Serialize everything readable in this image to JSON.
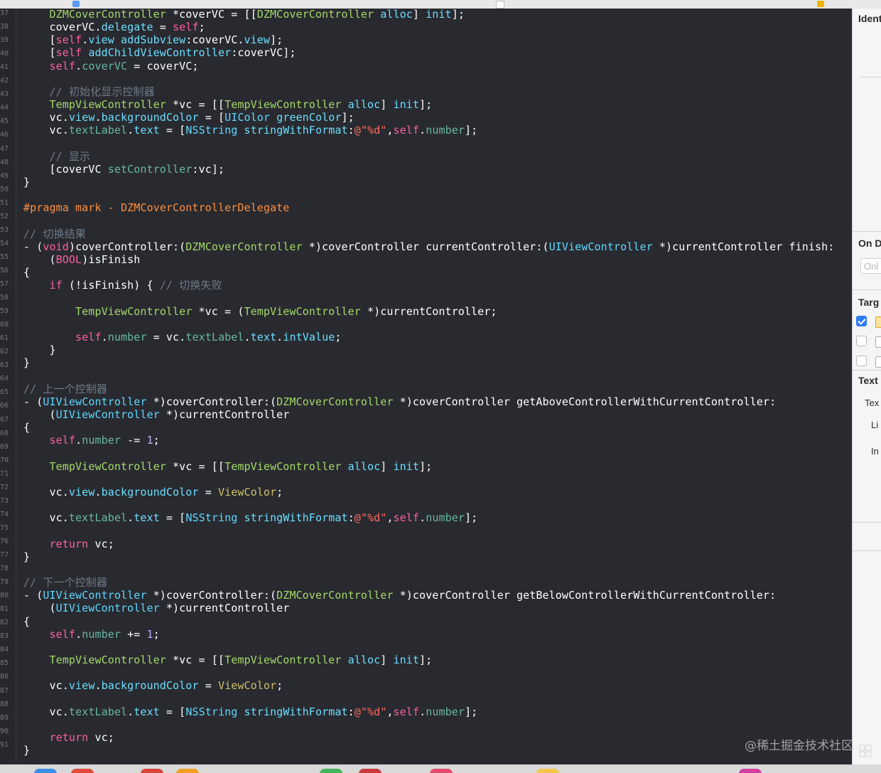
{
  "line_numbers": [
    "37",
    "38",
    "39",
    "40",
    "41",
    "42",
    "43",
    "44",
    "45",
    "46",
    "47",
    "48",
    "49",
    "50",
    "51",
    "52",
    "53",
    "54",
    "55",
    "56",
    "57",
    "58",
    "59",
    "60",
    "61",
    "62",
    "63",
    "64",
    "65",
    "66",
    "67",
    "68",
    "69",
    "70",
    "71",
    "72",
    "73",
    "74",
    "75",
    "76",
    "77",
    "78",
    "79",
    "80",
    "81",
    "82",
    "83",
    "84",
    "85",
    "86",
    "87",
    "88",
    "89",
    "90",
    "91"
  ],
  "code_lines": [
    [
      [
        "    ",
        "pl"
      ],
      [
        "DZMCoverController",
        "ty"
      ],
      [
        " *coverVC = [[",
        "pl"
      ],
      [
        "DZMCoverController",
        "ty"
      ],
      [
        " ",
        "pl"
      ],
      [
        "alloc",
        "ap"
      ],
      [
        "] ",
        "pl"
      ],
      [
        "init",
        "ap"
      ],
      [
        "];",
        "pl"
      ]
    ],
    [
      [
        "    coverVC.",
        "pl"
      ],
      [
        "delegate",
        "ap"
      ],
      [
        " = ",
        "pl"
      ],
      [
        "self",
        "kw"
      ],
      [
        ";",
        "pl"
      ]
    ],
    [
      [
        "    [",
        "pl"
      ],
      [
        "self",
        "kw"
      ],
      [
        ".",
        "pl"
      ],
      [
        "view",
        "ap"
      ],
      [
        " ",
        "pl"
      ],
      [
        "addSubview",
        "ap"
      ],
      [
        ":coverVC.",
        "pl"
      ],
      [
        "view",
        "ap"
      ],
      [
        "];",
        "pl"
      ]
    ],
    [
      [
        "    [",
        "pl"
      ],
      [
        "self",
        "kw"
      ],
      [
        " ",
        "pl"
      ],
      [
        "addChildViewController",
        "ap"
      ],
      [
        ":coverVC];",
        "pl"
      ]
    ],
    [
      [
        "    ",
        "pl"
      ],
      [
        "self",
        "kw"
      ],
      [
        ".",
        "pl"
      ],
      [
        "coverVC",
        "us"
      ],
      [
        " = coverVC;",
        "pl"
      ]
    ],
    [],
    [
      [
        "    // 初始化显示控制器",
        "cm"
      ]
    ],
    [
      [
        "    ",
        "pl"
      ],
      [
        "TempViewController",
        "ty"
      ],
      [
        " *vc = [[",
        "pl"
      ],
      [
        "TempViewController",
        "ty"
      ],
      [
        " ",
        "pl"
      ],
      [
        "alloc",
        "ap"
      ],
      [
        "] ",
        "pl"
      ],
      [
        "init",
        "ap"
      ],
      [
        "];",
        "pl"
      ]
    ],
    [
      [
        "    vc.",
        "pl"
      ],
      [
        "view",
        "ap"
      ],
      [
        ".",
        "pl"
      ],
      [
        "backgroundColor",
        "ap"
      ],
      [
        " = [",
        "pl"
      ],
      [
        "UIColor",
        "cl"
      ],
      [
        " ",
        "pl"
      ],
      [
        "greenColor",
        "ap"
      ],
      [
        "];",
        "pl"
      ]
    ],
    [
      [
        "    vc.",
        "pl"
      ],
      [
        "textLabel",
        "us"
      ],
      [
        ".",
        "pl"
      ],
      [
        "text",
        "ap"
      ],
      [
        " = [",
        "pl"
      ],
      [
        "NSString",
        "cl"
      ],
      [
        " ",
        "pl"
      ],
      [
        "stringWithFormat",
        "ap"
      ],
      [
        ":",
        "pl"
      ],
      [
        "@\"%d\"",
        "st"
      ],
      [
        ",",
        "pl"
      ],
      [
        "self",
        "kw"
      ],
      [
        ".",
        "pl"
      ],
      [
        "number",
        "us"
      ],
      [
        "];",
        "pl"
      ]
    ],
    [],
    [
      [
        "    // 显示",
        "cm"
      ]
    ],
    [
      [
        "    [coverVC ",
        "pl"
      ],
      [
        "setController",
        "us"
      ],
      [
        ":vc];",
        "pl"
      ]
    ],
    [
      [
        "}",
        "pl"
      ]
    ],
    [],
    [
      [
        "#pragma mark - DZMCoverControllerDelegate",
        "pp"
      ]
    ],
    [],
    [
      [
        "// 切换结果",
        "cm"
      ]
    ],
    [
      [
        "- (",
        "pl"
      ],
      [
        "void",
        "kw"
      ],
      [
        ")coverController:(",
        "pl"
      ],
      [
        "DZMCoverController",
        "ty"
      ],
      [
        " *)coverController currentController:(",
        "pl"
      ],
      [
        "UIViewController",
        "cl"
      ],
      [
        " *)currentController finish:",
        "pl"
      ]
    ],
    [
      [
        "    (",
        "pl"
      ],
      [
        "BOOL",
        "kw"
      ],
      [
        ")isFinish",
        "pl"
      ]
    ],
    [
      [
        "{",
        "pl"
      ]
    ],
    [
      [
        "    ",
        "pl"
      ],
      [
        "if",
        "kw"
      ],
      [
        " (!isFinish) { ",
        "pl"
      ],
      [
        "// 切换失败",
        "cm"
      ]
    ],
    [],
    [
      [
        "        ",
        "pl"
      ],
      [
        "TempViewController",
        "ty"
      ],
      [
        " *vc = (",
        "pl"
      ],
      [
        "TempViewController",
        "ty"
      ],
      [
        " *)currentController;",
        "pl"
      ]
    ],
    [],
    [
      [
        "        ",
        "pl"
      ],
      [
        "self",
        "kw"
      ],
      [
        ".",
        "pl"
      ],
      [
        "number",
        "us"
      ],
      [
        " = vc.",
        "pl"
      ],
      [
        "textLabel",
        "us"
      ],
      [
        ".",
        "pl"
      ],
      [
        "text",
        "ap"
      ],
      [
        ".",
        "pl"
      ],
      [
        "intValue",
        "ap"
      ],
      [
        ";",
        "pl"
      ]
    ],
    [
      [
        "    }",
        "pl"
      ]
    ],
    [
      [
        "}",
        "pl"
      ]
    ],
    [],
    [
      [
        "// 上一个控制器",
        "cm"
      ]
    ],
    [
      [
        "- (",
        "pl"
      ],
      [
        "UIViewController",
        "cl"
      ],
      [
        " *)coverController:(",
        "pl"
      ],
      [
        "DZMCoverController",
        "ty"
      ],
      [
        " *)coverController getAboveControllerWithCurrentController:",
        "pl"
      ]
    ],
    [
      [
        "    (",
        "pl"
      ],
      [
        "UIViewController",
        "cl"
      ],
      [
        " *)currentController",
        "pl"
      ]
    ],
    [
      [
        "{",
        "pl"
      ]
    ],
    [
      [
        "    ",
        "pl"
      ],
      [
        "self",
        "kw"
      ],
      [
        ".",
        "pl"
      ],
      [
        "number",
        "us"
      ],
      [
        " -= ",
        "pl"
      ],
      [
        "1",
        "pr"
      ],
      [
        ";",
        "pl"
      ]
    ],
    [],
    [
      [
        "    ",
        "pl"
      ],
      [
        "TempViewController",
        "ty"
      ],
      [
        " *vc = [[",
        "pl"
      ],
      [
        "TempViewController",
        "ty"
      ],
      [
        " ",
        "pl"
      ],
      [
        "alloc",
        "ap"
      ],
      [
        "] ",
        "pl"
      ],
      [
        "init",
        "ap"
      ],
      [
        "];",
        "pl"
      ]
    ],
    [],
    [
      [
        "    vc.",
        "pl"
      ],
      [
        "view",
        "ap"
      ],
      [
        ".",
        "pl"
      ],
      [
        "backgroundColor",
        "ap"
      ],
      [
        " = ",
        "pl"
      ],
      [
        "ViewColor",
        "nu"
      ],
      [
        ";",
        "pl"
      ]
    ],
    [],
    [
      [
        "    vc.",
        "pl"
      ],
      [
        "textLabel",
        "us"
      ],
      [
        ".",
        "pl"
      ],
      [
        "text",
        "ap"
      ],
      [
        " = [",
        "pl"
      ],
      [
        "NSString",
        "cl"
      ],
      [
        " ",
        "pl"
      ],
      [
        "stringWithFormat",
        "ap"
      ],
      [
        ":",
        "pl"
      ],
      [
        "@\"%d\"",
        "st"
      ],
      [
        ",",
        "pl"
      ],
      [
        "self",
        "kw"
      ],
      [
        ".",
        "pl"
      ],
      [
        "number",
        "us"
      ],
      [
        "];",
        "pl"
      ]
    ],
    [],
    [
      [
        "    ",
        "pl"
      ],
      [
        "return",
        "kw"
      ],
      [
        " vc;",
        "pl"
      ]
    ],
    [
      [
        "}",
        "pl"
      ]
    ],
    [],
    [
      [
        "// 下一个控制器",
        "cm"
      ]
    ],
    [
      [
        "- (",
        "pl"
      ],
      [
        "UIViewController",
        "cl"
      ],
      [
        " *)coverController:(",
        "pl"
      ],
      [
        "DZMCoverController",
        "ty"
      ],
      [
        " *)coverController getBelowControllerWithCurrentController:",
        "pl"
      ]
    ],
    [
      [
        "    (",
        "pl"
      ],
      [
        "UIViewController",
        "cl"
      ],
      [
        " *)currentController",
        "pl"
      ]
    ],
    [
      [
        "{",
        "pl"
      ]
    ],
    [
      [
        "    ",
        "pl"
      ],
      [
        "self",
        "kw"
      ],
      [
        ".",
        "pl"
      ],
      [
        "number",
        "us"
      ],
      [
        " += ",
        "pl"
      ],
      [
        "1",
        "pr"
      ],
      [
        ";",
        "pl"
      ]
    ],
    [],
    [
      [
        "    ",
        "pl"
      ],
      [
        "TempViewController",
        "ty"
      ],
      [
        " *vc = [[",
        "pl"
      ],
      [
        "TempViewController",
        "ty"
      ],
      [
        " ",
        "pl"
      ],
      [
        "alloc",
        "ap"
      ],
      [
        "] ",
        "pl"
      ],
      [
        "init",
        "ap"
      ],
      [
        "];",
        "pl"
      ]
    ],
    [],
    [
      [
        "    vc.",
        "pl"
      ],
      [
        "view",
        "ap"
      ],
      [
        ".",
        "pl"
      ],
      [
        "backgroundColor",
        "ap"
      ],
      [
        " = ",
        "pl"
      ],
      [
        "ViewColor",
        "nu"
      ],
      [
        ";",
        "pl"
      ]
    ],
    [],
    [
      [
        "    vc.",
        "pl"
      ],
      [
        "textLabel",
        "us"
      ],
      [
        ".",
        "pl"
      ],
      [
        "text",
        "ap"
      ],
      [
        " = [",
        "pl"
      ],
      [
        "NSString",
        "cl"
      ],
      [
        " ",
        "pl"
      ],
      [
        "stringWithFormat",
        "ap"
      ],
      [
        ":",
        "pl"
      ],
      [
        "@\"%d\"",
        "st"
      ],
      [
        ",",
        "pl"
      ],
      [
        "self",
        "kw"
      ],
      [
        ".",
        "pl"
      ],
      [
        "number",
        "us"
      ],
      [
        "];",
        "pl"
      ]
    ],
    [],
    [
      [
        "    ",
        "pl"
      ],
      [
        "return",
        "kw"
      ],
      [
        " vc;",
        "pl"
      ]
    ],
    [
      [
        "}",
        "pl"
      ]
    ]
  ],
  "inspector": {
    "identity_header": "Ident",
    "on_demand_header": "On D",
    "on_demand_placeholder": "Onl",
    "target_header": "Targ",
    "targets": [
      {
        "checked": true
      },
      {
        "checked": false
      },
      {
        "checked": false
      }
    ],
    "text_header": "Text",
    "text_settings": [
      "Tex",
      "Li",
      "In"
    ]
  },
  "watermark": "@稀土掘金技术社区",
  "colors": {
    "editor_background": "#292a30",
    "keyword": "#fc5fa3",
    "type": "#a3d968",
    "comment": "#6c7986",
    "string": "#fc6a5d",
    "preprocessor": "#fd8f3f",
    "checkbox_accent": "#2f7cf6"
  }
}
